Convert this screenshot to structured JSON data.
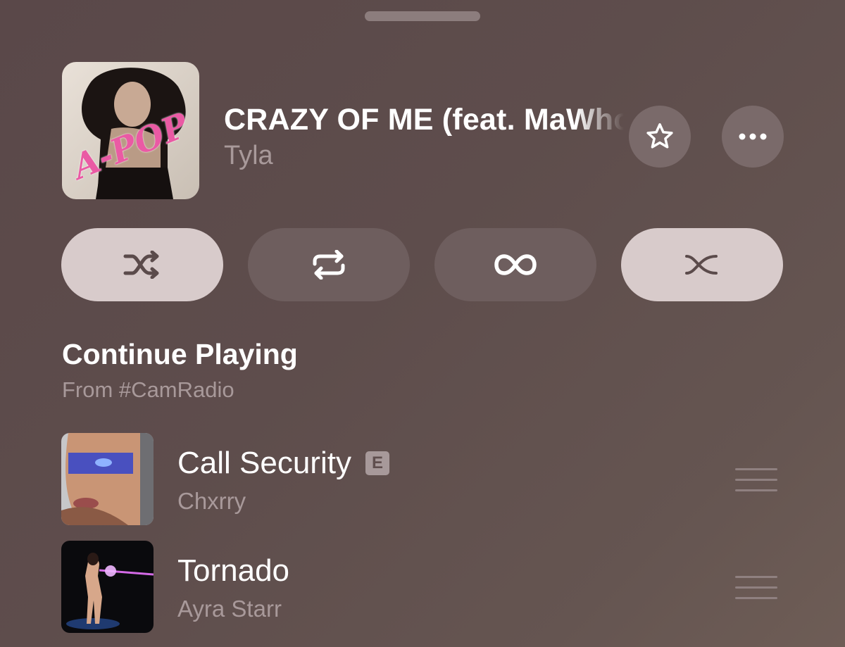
{
  "now_playing": {
    "title": "CRAZY OF ME (feat. MaWhoo)",
    "artist": "Tyla",
    "artwork_text": "A-POP"
  },
  "controls": [
    {
      "icon": "shuffle-icon",
      "state": "on"
    },
    {
      "icon": "repeat-icon",
      "state": "off"
    },
    {
      "icon": "infinity-icon",
      "state": "off"
    },
    {
      "icon": "crossfade-icon",
      "state": "on"
    }
  ],
  "section": {
    "title": "Continue Playing",
    "subtitle": "From #CamRadio"
  },
  "queue": [
    {
      "title": "Call Security",
      "artist": "Chxrry",
      "explicit": "E"
    },
    {
      "title": "Tornado",
      "artist": "Ayra Starr"
    }
  ],
  "colors": {
    "background": "#5e4d4c",
    "secondary_text": "#a8999a",
    "control_active": "#d8cbcb",
    "control_inactive": "#6e5e5e"
  }
}
